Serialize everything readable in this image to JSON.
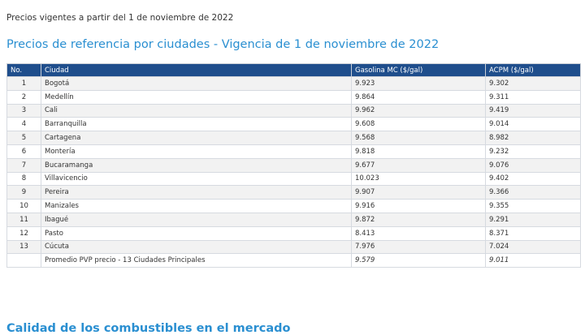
{
  "intro": "Precios vigentes a partir del 1 de noviembre de 2022",
  "heading": "Precios de referencia por ciudades - Vigencia de 1 de noviembre de 2022",
  "next_heading": "Calidad de los combustibles en el mercado",
  "table": {
    "headers": [
      "No.",
      "Ciudad",
      "Gasolina MC ($/gal)",
      "ACPM ($/gal)"
    ],
    "rows": [
      {
        "no": "1",
        "city": "Bogotá",
        "gasoline": "9.923",
        "acpm": "9.302"
      },
      {
        "no": "2",
        "city": "Medellín",
        "gasoline": "9.864",
        "acpm": "9.311"
      },
      {
        "no": "3",
        "city": "Cali",
        "gasoline": "9.962",
        "acpm": "9.419"
      },
      {
        "no": "4",
        "city": "Barranquilla",
        "gasoline": "9.608",
        "acpm": "9.014"
      },
      {
        "no": "5",
        "city": "Cartagena",
        "gasoline": "9.568",
        "acpm": "8.982"
      },
      {
        "no": "6",
        "city": "Montería",
        "gasoline": "9.818",
        "acpm": "9.232"
      },
      {
        "no": "7",
        "city": "Bucaramanga",
        "gasoline": "9.677",
        "acpm": "9.076"
      },
      {
        "no": "8",
        "city": "Villavicencio",
        "gasoline": "10.023",
        "acpm": "9.402"
      },
      {
        "no": "9",
        "city": "Pereira",
        "gasoline": "9.907",
        "acpm": "9.366"
      },
      {
        "no": "10",
        "city": "Manizales",
        "gasoline": "9.916",
        "acpm": "9.355"
      },
      {
        "no": "11",
        "city": "Ibagué",
        "gasoline": "9.872",
        "acpm": "9.291"
      },
      {
        "no": "12",
        "city": "Pasto",
        "gasoline": "8.413",
        "acpm": "8.371"
      },
      {
        "no": "13",
        "city": "Cúcuta",
        "gasoline": "7.976",
        "acpm": "7.024"
      }
    ],
    "average": {
      "no": "",
      "city": "Promedio PVP precio - 13 Ciudades Principales",
      "gasoline": "9.579",
      "acpm": "9.011"
    }
  },
  "colors": {
    "header_bg": "#1f4e8c",
    "heading": "#2a8fd1",
    "stripe": "#f2f2f2"
  }
}
